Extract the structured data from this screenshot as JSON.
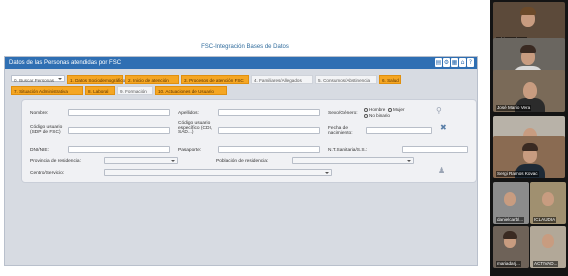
{
  "app": {
    "title": "FSC-Integración Bases de Datos"
  },
  "window": {
    "title": "Datos de las Personas atendidas por FSC",
    "title_icons": [
      "pdf-icon",
      "gear-icon",
      "grid-icon",
      "home-icon",
      "help-icon"
    ],
    "title_glyphs": [
      "▤",
      "⚙",
      "▦",
      "⌂",
      "?"
    ]
  },
  "tabs": [
    {
      "label": "0. Buscar Personas",
      "selected": true,
      "highlight": false
    },
    {
      "label": "1. Datos Sociodemográficos",
      "selected": false,
      "highlight": true
    },
    {
      "label": "2. Inicio de atención",
      "selected": false,
      "highlight": true
    },
    {
      "label": "3. Procesos de atención FSC",
      "selected": false,
      "highlight": true
    },
    {
      "label": "4. Familiares/Allegados",
      "selected": false,
      "highlight": false
    },
    {
      "label": "5. Consumos/Abstinencia",
      "selected": false,
      "highlight": false
    },
    {
      "label": "6. Salud",
      "selected": false,
      "highlight": true
    },
    {
      "label": "7. Situación Administrativa",
      "selected": false,
      "highlight": true
    },
    {
      "label": "8. Laboral",
      "selected": false,
      "highlight": true
    },
    {
      "label": "9. Formación",
      "selected": false,
      "highlight": false
    },
    {
      "label": "10. Actuaciones de Usuario",
      "selected": false,
      "highlight": true
    }
  ],
  "form": {
    "nombre": "Nombre:",
    "apellidos": "Apellidos:",
    "sexo_genero": "Sexo/Género:",
    "hombre": "Hombre",
    "mujer": "Mujer",
    "no_binario": "No binario",
    "codigo_usuario": "Código usuario (SDP de FSC)",
    "codigo_usuario_especifico": "Código usuario específico (CDI, SAD...)",
    "fecha_nacimiento": "Fecha de nacimiento:",
    "dni_nie": "DNI/NIE:",
    "pasaporte": "Pasaporte:",
    "nt_sanitaria": "N.T.Sanitaria/S.S.:",
    "provincia_residencia": "Provincia de residencia:",
    "poblacion_residencia": "Población de residencia:",
    "centro_servicio": "Centro/Servicio:"
  },
  "participants": [
    {
      "name": "adriana.piez...",
      "icon": "user-video-icon"
    },
    {
      "name": "",
      "icon": "user-video-icon"
    },
    {
      "name": "José Mario Vera",
      "icon": "user-video-icon"
    },
    {
      "name": "dicunternica",
      "icon": "user-video-icon"
    },
    {
      "name": "Sergi Ramos Kovac",
      "icon": "user-video-icon"
    },
    {
      "name": "danielcarbl...",
      "icon": "user-video-icon"
    },
    {
      "name": "ICLAUDIA",
      "icon": "user-video-icon"
    },
    {
      "name": "mariadarj...",
      "icon": "user-video-icon"
    },
    {
      "name": "ACTIVAD...",
      "icon": "user-video-icon"
    }
  ],
  "colors": {
    "titlebar": "#2f6fb3",
    "tab_highlight": "#f5a623",
    "app_title": "#2f6b9c"
  }
}
